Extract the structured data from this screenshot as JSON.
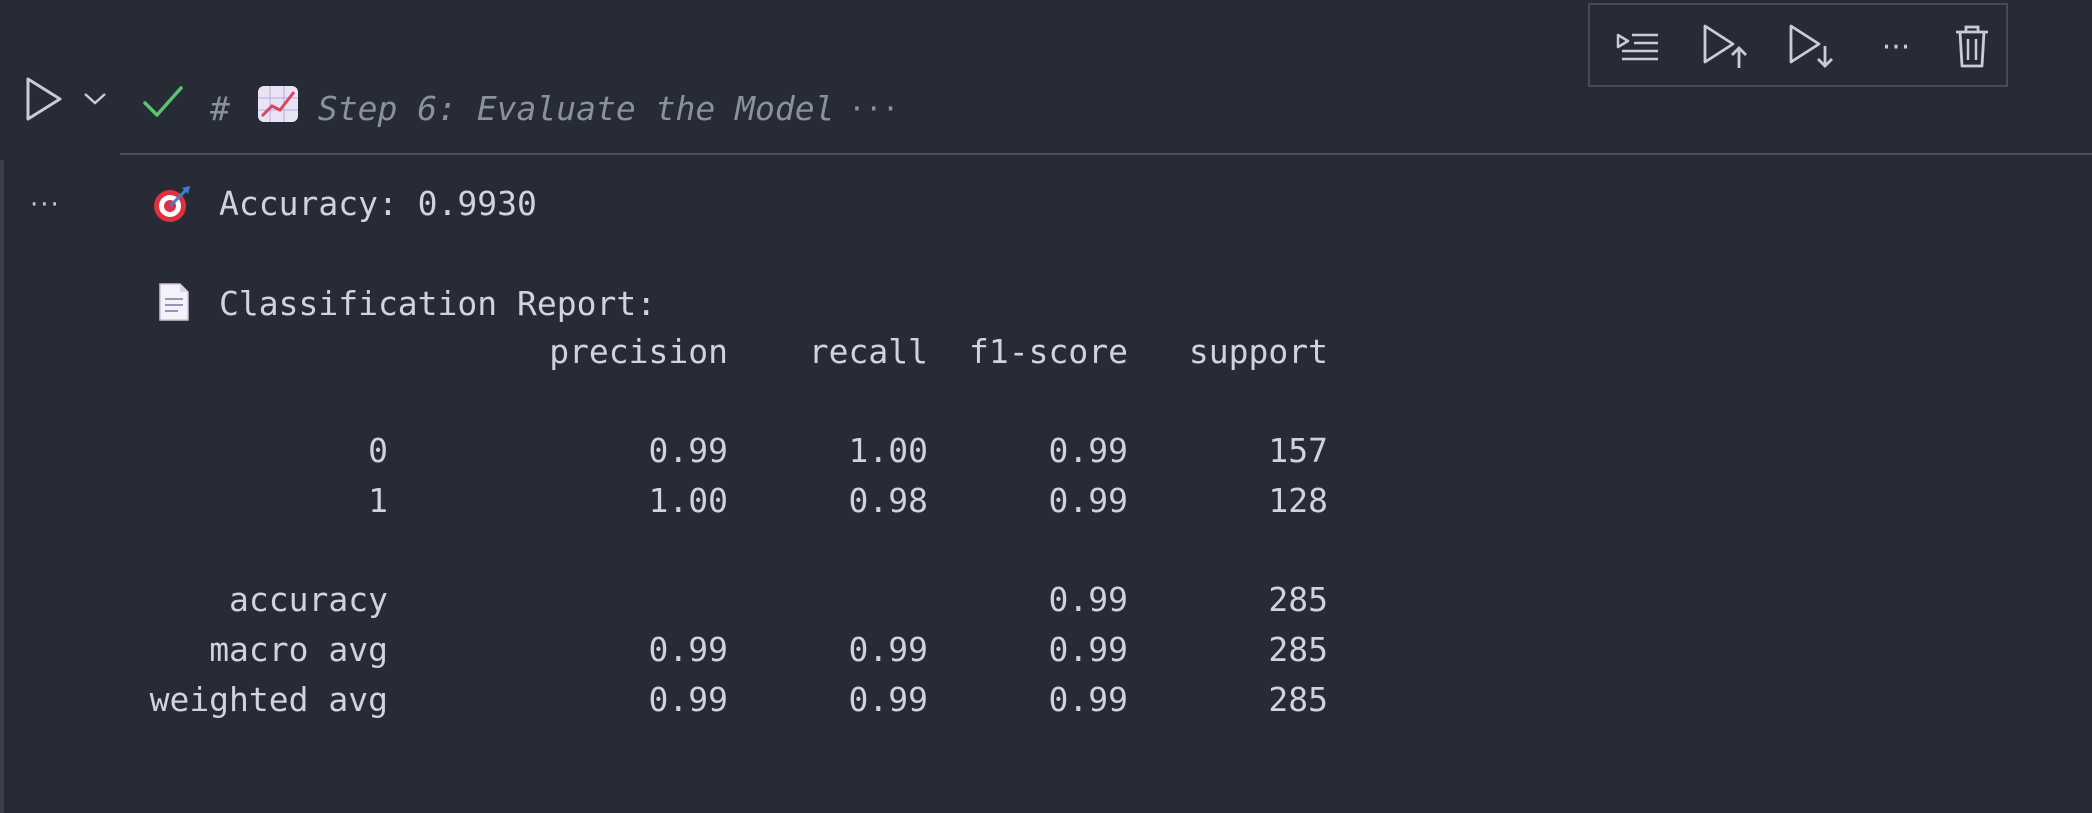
{
  "toolbar": {
    "buttons": [
      {
        "name": "execute-above-and-insert-icon"
      },
      {
        "name": "run-cells-above-icon"
      },
      {
        "name": "run-cells-below-icon"
      },
      {
        "name": "more-actions-icon",
        "label": "···"
      },
      {
        "name": "delete-cell-icon"
      }
    ]
  },
  "cell": {
    "status": "success",
    "header_hash": "#",
    "header_emoji": "📈",
    "header_text": "Step 6: Evaluate the Model",
    "header_more": "···",
    "output_menu": "···"
  },
  "output": {
    "accuracy_emoji": "🎯",
    "accuracy_line": "Accuracy: 0.9930",
    "report_emoji": "📄",
    "report_title": "Classification Report:",
    "columns": [
      "precision",
      "recall",
      "f1-score",
      "support"
    ],
    "rows": [
      {
        "label": "0",
        "precision": "0.99",
        "recall": "1.00",
        "f1": "0.99",
        "support": "157"
      },
      {
        "label": "1",
        "precision": "1.00",
        "recall": "0.98",
        "f1": "0.99",
        "support": "128"
      },
      {
        "label": "accuracy",
        "precision": "",
        "recall": "",
        "f1": "0.99",
        "support": "285"
      },
      {
        "label": "macro avg",
        "precision": "0.99",
        "recall": "0.99",
        "f1": "0.99",
        "support": "285"
      },
      {
        "label": "weighted avg",
        "precision": "0.99",
        "recall": "0.99",
        "f1": "0.99",
        "support": "285"
      }
    ]
  },
  "colors": {
    "background": "#272b35",
    "text": "#cfd3dc",
    "muted": "#8a909c",
    "success": "#5cc26f"
  }
}
